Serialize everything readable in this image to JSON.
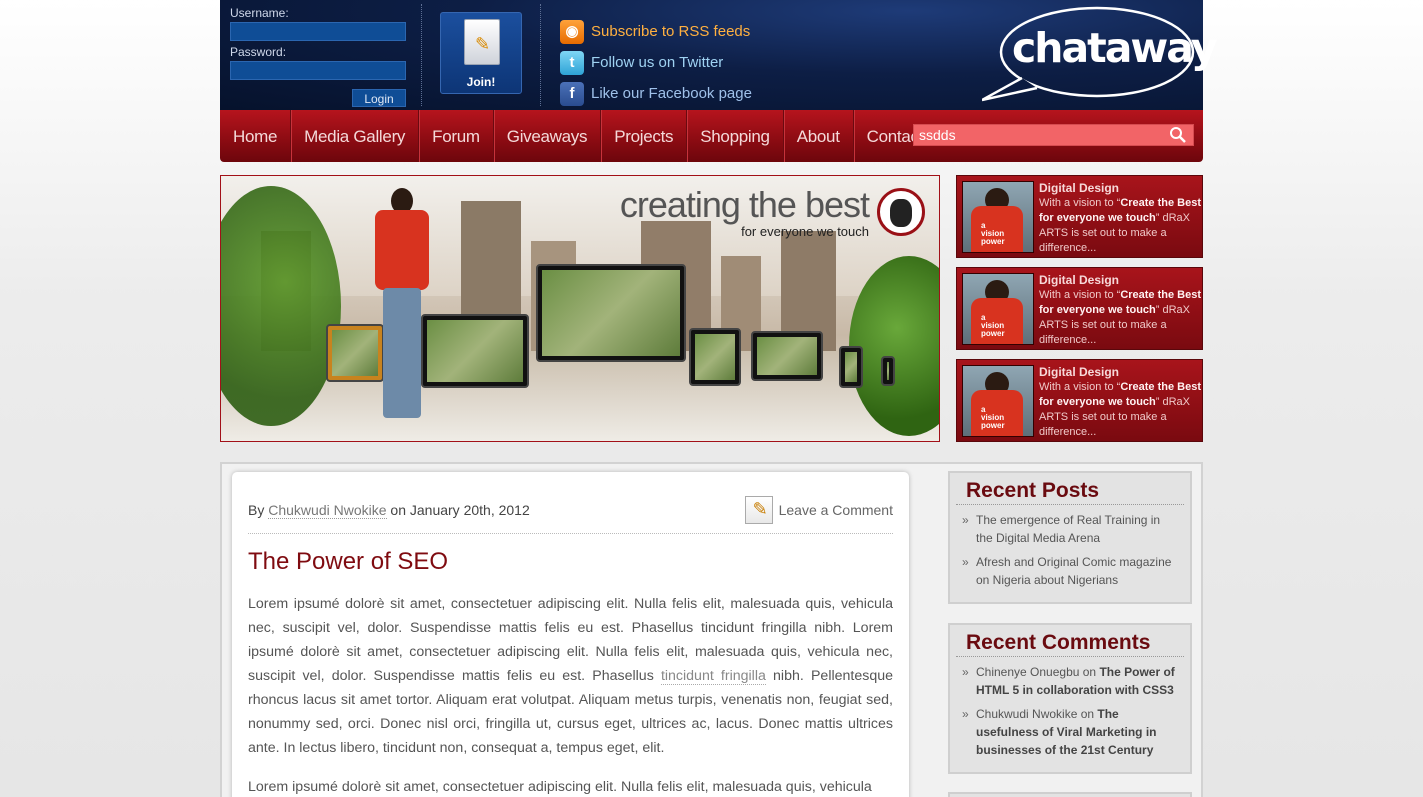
{
  "login": {
    "username_label": "Username:",
    "password_label": "Password:",
    "login_button": "Login"
  },
  "join": {
    "label": "Join!"
  },
  "social": [
    {
      "icon": "rss-icon",
      "label": "Subscribe to RSS feeds"
    },
    {
      "icon": "twitter-icon",
      "label": "Follow us on Twitter"
    },
    {
      "icon": "facebook-icon",
      "label": "Like our Facebook page"
    }
  ],
  "logo": {
    "text": "chataway"
  },
  "nav": {
    "items": [
      "Home",
      "Media Gallery",
      "Forum",
      "Giveaways",
      "Projects",
      "Shopping",
      "About",
      "Contact us"
    ],
    "search_value": "ssdds"
  },
  "banner": {
    "headline": "creating the best",
    "subline": "for everyone we touch"
  },
  "features": [
    {
      "title": "Digital Design",
      "desc_pre": "With a vision to “",
      "desc_bold": "Create the Best for everyone we touch",
      "desc_post": "” dRaX ARTS is set out to make a difference..."
    },
    {
      "title": "Digital Design",
      "desc_pre": "With a vision to “",
      "desc_bold": "Create the Best for everyone we touch",
      "desc_post": "” dRaX ARTS is set out to make a difference..."
    },
    {
      "title": "Digital Design",
      "desc_pre": "With a vision to “",
      "desc_bold": "Create the Best for everyone we touch",
      "desc_post": "” dRaX ARTS is set out to make a difference..."
    }
  ],
  "post": {
    "by": "By",
    "author": "Chukwudi Nwokike",
    "on_date": "on January 20th, 2012",
    "comment_link": "Leave a Comment",
    "title": "The Power of SEO",
    "p1_a": "Lorem ipsumé dolorè sit amet, consectetuer adipiscing elit. Nulla felis elit, malesuada quis, vehicula nec, suscipit vel, dolor. Suspendisse mattis felis eu est. Phasellus tincidunt fringilla nibh. Lorem ipsumé dolorè sit amet, consectetuer adipiscing elit. Nulla felis elit, malesuada quis, vehicula nec, suscipit vel, dolor. Suspendisse mattis felis eu est. Phasellus ",
    "p1_link": "tincidunt fringilla",
    "p1_b": " nibh. Pellentesque rhoncus lacus sit amet tortor. Aliquam erat volutpat. Aliquam metus turpis, venenatis non, feugiat sed, nonummy sed, orci. Donec nisl orci, fringilla ut, cursus eget, ultrices ac, lacus. Donec mattis ultrices ante. In lectus libero, tincidunt non, consequat a, tempus eget, elit.",
    "p2": "Lorem ipsumé dolorè sit amet, consectetuer adipiscing elit. Nulla felis elit, malesuada quis, vehicula"
  },
  "recent_posts": {
    "title": "Recent Posts",
    "items": [
      "The emergence of Real Training in the Digital Media Arena",
      "Afresh and Original Comic magazine on Nigeria about Nigerians"
    ]
  },
  "recent_comments": {
    "title": "Recent Comments",
    "items": [
      {
        "author": "Chinenye Onuegbu",
        "on": " on ",
        "post": "The Power of HTML 5 in collaboration with CSS3"
      },
      {
        "author": "Chukwudi Nwokike",
        "on": " on ",
        "post": "The usefulness of Viral Marketing in businesses of the 21st Century"
      }
    ]
  },
  "colors": {
    "nav_red": "#9b1018",
    "header_navy": "#0d1e45",
    "title_red": "#7f0b10"
  }
}
